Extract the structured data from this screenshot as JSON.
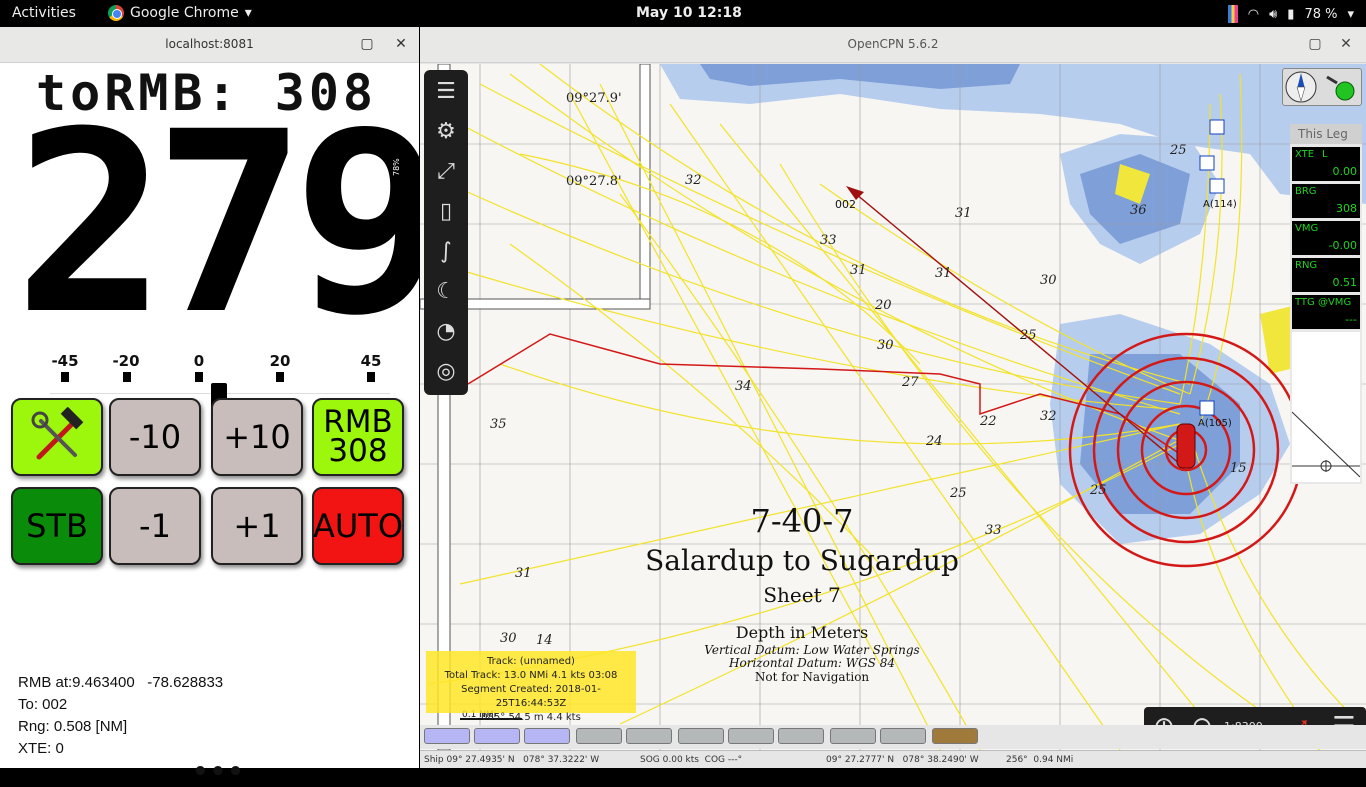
{
  "topbar": {
    "activities": "Activities",
    "app_name": "Google Chrome",
    "clock": "May 10  12:18",
    "battery": "78 %"
  },
  "browser": {
    "title": "localhost:8081",
    "header_label": "toRMB: 308",
    "heading": "279",
    "battery_badge": "78%",
    "scale": [
      "-45",
      "-20",
      "0",
      "20",
      "45"
    ],
    "buttons": {
      "minus10": "-10",
      "plus10": "+10",
      "rmb_line1": "RMB",
      "rmb_line2": "308",
      "stb": "STB",
      "minus1": "-1",
      "plus1": "+1",
      "auto": "AUTO"
    },
    "info": {
      "rmb_at": "RMB at:9.463400   -78.628833",
      "to": "To: 002",
      "rng": "Rng: 0.508 [NM]",
      "xte": "XTE: 0"
    },
    "more": "•••"
  },
  "opencpn": {
    "title": "OpenCPN 5.6.2",
    "chart": {
      "title_line1": "7-40-7",
      "title_line2": "Salardup to Sugardup",
      "title_line3": "Sheet 7",
      "title_line4": "Depth in Meters",
      "datum1": "Vertical Datum: Low Water Springs",
      "datum2": "Horizontal Datum: WGS 84",
      "datum3": "Not for Navigation",
      "lat1": "09°27.9'",
      "lat2": "09°27.8'",
      "waypoint": "002",
      "anchors": [
        "A(114)",
        "A(105)"
      ],
      "scale_bar": "0.1 NMi",
      "soundings": [
        "32",
        "33",
        "31",
        "30",
        "20",
        "22",
        "24",
        "25",
        "27",
        "34",
        "35",
        "36",
        "14",
        "15"
      ]
    },
    "dashboard": {
      "header": "This Leg",
      "xte_label": "XTE",
      "xte_side": "L",
      "xte_value": "0.00",
      "brg_label": "BRG",
      "brg_value": "308",
      "vmg_label": "VMG",
      "vmg_value": "-0.00",
      "rng_label": "RNG",
      "rng_value": "0.51",
      "ttg_label": "TTG @VMG",
      "ttg_value": "---"
    },
    "track_info": {
      "line1": "Track: (unnamed)",
      "line2": "Total Track: 13.0 NMi  4.1 kts  03:08",
      "line3": "Segment Created: 2018-01-25T16:44:53Z",
      "line4": "085° 54.5 m  4.4 kts"
    },
    "zoom_scale": "1:8300",
    "status": {
      "ship": "Ship 09° 27.4935' N   078° 37.3222' W",
      "sog": "SOG 0.00 kts  COG ---°",
      "cursor": "09° 27.2777' N   078° 38.2490' W",
      "brg": "256°  0.94 NMi"
    }
  },
  "colors": {
    "lime": "#9cf70c",
    "green": "#0a8c0a",
    "red": "#f21313",
    "grey_btn": "#c9bdbb",
    "track_yellow": "#f2e32a",
    "deep_blue": "#7e9fd8",
    "shallow_blue": "#b7cdee"
  }
}
